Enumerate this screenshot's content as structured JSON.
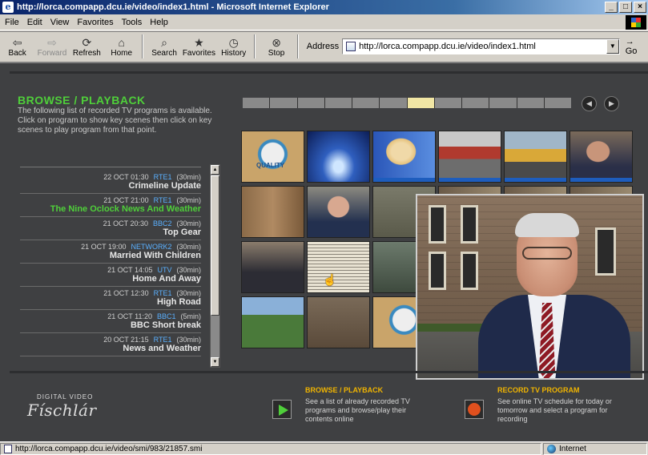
{
  "window": {
    "title": "http://lorca.compapp.dcu.ie/video/index1.html - Microsoft Internet Explorer"
  },
  "menu": [
    "File",
    "Edit",
    "View",
    "Favorites",
    "Tools",
    "Help"
  ],
  "toolbar": {
    "back": "Back",
    "forward": "Forward",
    "refresh": "Refresh",
    "home": "Home",
    "search": "Search",
    "favorites": "Favorites",
    "history": "History",
    "stop": "Stop",
    "address_label": "Address",
    "address_value": "http://lorca.compapp.dcu.ie/video/index1.html",
    "go": "Go"
  },
  "page": {
    "browse_title": "BROWSE / PLAYBACK",
    "browse_desc": "The following list of recorded TV programs is available. Click on program to show key scenes then click on key scenes to play program from that point.",
    "timeline_segments": 12,
    "timeline_active_index": 6,
    "programs": [
      {
        "date": "22 OCT 01:30",
        "channel": "RTE1",
        "duration": "(30min)",
        "title": "Crimeline Update",
        "selected": false
      },
      {
        "date": "21 OCT 21:00",
        "channel": "RTE1",
        "duration": "(30min)",
        "title": "The Nine Oclock News And Weather",
        "selected": true
      },
      {
        "date": "21 OCT 20:30",
        "channel": "BBC2",
        "duration": "(30min)",
        "title": "Top Gear",
        "selected": false
      },
      {
        "date": "21 OCT 19:00",
        "channel": "NETWORK2",
        "duration": "(30min)",
        "title": "Married With Children",
        "selected": false
      },
      {
        "date": "21 OCT 14:05",
        "channel": "UTV",
        "duration": "(30min)",
        "title": "Home And Away",
        "selected": false
      },
      {
        "date": "21 OCT 12:30",
        "channel": "RTE1",
        "duration": "(30min)",
        "title": "High Road",
        "selected": false
      },
      {
        "date": "21 OCT 11:20",
        "channel": "BBC1",
        "duration": "(5min)",
        "title": "BBC Short break",
        "selected": false
      },
      {
        "date": "20 OCT 21:15",
        "channel": "RTE1",
        "duration": "(30min)",
        "title": "News and Weather",
        "selected": false
      }
    ],
    "thumb_text": "QUALITY",
    "footer": {
      "logo_small": "DIGITAL VIDEO",
      "logo_big": "Físchlár",
      "browse_title": "BROWSE / PLAYBACK",
      "browse_desc": "See a list of already recorded TV programs and browse/play their contents online",
      "record_title": "RECORD TV PROGRAM",
      "record_desc": "See online TV schedule for today or tomorrow and select a program for recording"
    }
  },
  "status": {
    "url": "http://lorca.compapp.dcu.ie/video/smi/983/21857.smi",
    "zone": "Internet"
  }
}
